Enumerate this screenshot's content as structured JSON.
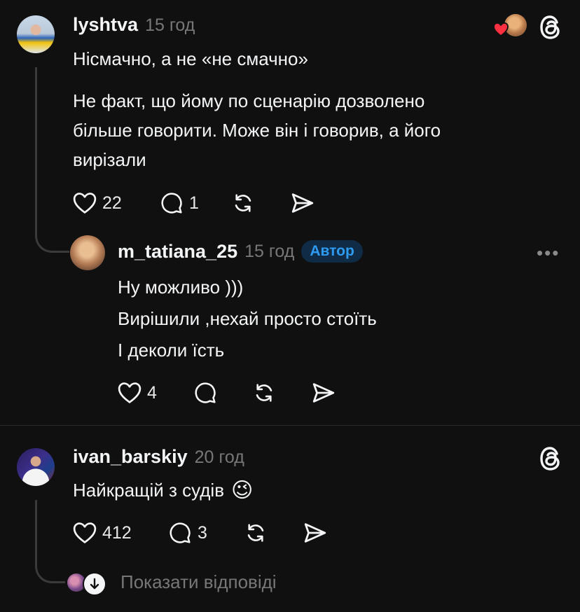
{
  "comments": [
    {
      "username": "lyshtva",
      "time": "15 год",
      "text_line1": "Нісмачно, а не «не смачно»",
      "paragraph2": [
        "Не факт, що йому по сценарію дозволено",
        "більше говорити. Може він і говорив, а його",
        "вирізали"
      ],
      "likes": "22",
      "replies": "1"
    },
    {
      "username": "m_tatiana_25",
      "time": "15 год",
      "badge": "Автор",
      "lines": [
        "Ну можливо )))",
        "Вирішили ,нехай просто стоїть",
        "І деколи їсть"
      ],
      "likes": "4"
    },
    {
      "username": "ivan_barskiy",
      "time": "20 год",
      "text": "Найкращій з судів",
      "emoji": "😉",
      "likes": "412",
      "replies": "3"
    }
  ],
  "show_replies": "Показати відповіді",
  "more_label": "•••",
  "colors": {
    "background": "#101010",
    "badge_text": "#2f9bf0",
    "heart": "#ff3040"
  }
}
